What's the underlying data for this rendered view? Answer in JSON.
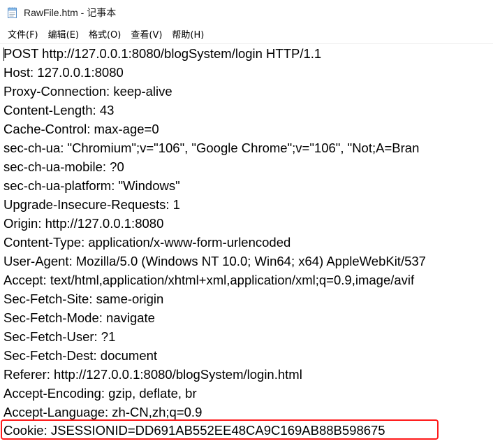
{
  "window": {
    "title": "RawFile.htm - 记事本",
    "app_icon": "notepad-icon"
  },
  "menu": {
    "items": [
      {
        "id": "file",
        "label": "文件(F)"
      },
      {
        "id": "edit",
        "label": "编辑(E)"
      },
      {
        "id": "format",
        "label": "格式(O)"
      },
      {
        "id": "view",
        "label": "查看(V)"
      },
      {
        "id": "help",
        "label": "帮助(H)"
      }
    ]
  },
  "editor": {
    "lines": [
      "POST http://127.0.0.1:8080/blogSystem/login HTTP/1.1",
      "Host: 127.0.0.1:8080",
      "Proxy-Connection: keep-alive",
      "Content-Length: 43",
      "Cache-Control: max-age=0",
      "sec-ch-ua: \"Chromium\";v=\"106\", \"Google Chrome\";v=\"106\", \"Not;A=Bran",
      "sec-ch-ua-mobile: ?0",
      "sec-ch-ua-platform: \"Windows\"",
      "Upgrade-Insecure-Requests: 1",
      "Origin: http://127.0.0.1:8080",
      "Content-Type: application/x-www-form-urlencoded",
      "User-Agent: Mozilla/5.0 (Windows NT 10.0; Win64; x64) AppleWebKit/537",
      "Accept: text/html,application/xhtml+xml,application/xml;q=0.9,image/avif",
      "Sec-Fetch-Site: same-origin",
      "Sec-Fetch-Mode: navigate",
      "Sec-Fetch-User: ?1",
      "Sec-Fetch-Dest: document",
      "Referer: http://127.0.0.1:8080/blogSystem/login.html",
      "Accept-Encoding: gzip, deflate, br",
      "Accept-Language: zh-CN,zh;q=0.9",
      "Cookie: JSESSIONID=DD691AB552EE48CA9C169AB88B598675"
    ],
    "highlight_color": "#ff1a1a"
  }
}
